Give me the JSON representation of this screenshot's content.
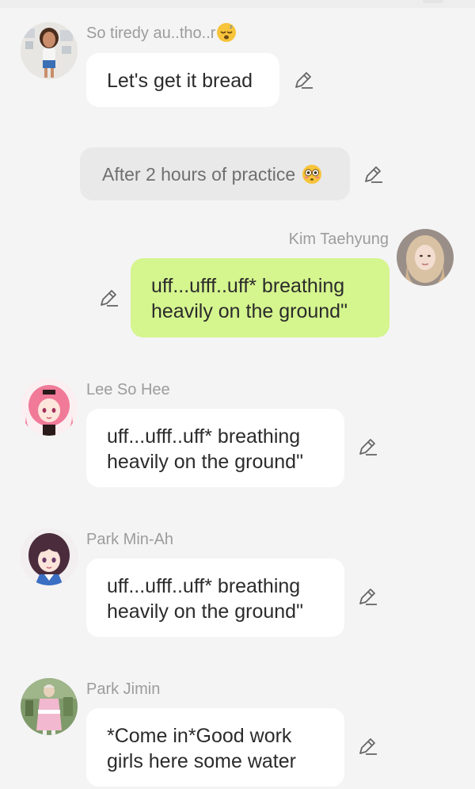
{
  "messages": [
    {
      "sender": "So tiredy au..tho..r",
      "sender_emoji": "sleeping-face",
      "text": "Let's get it bread",
      "side": "left",
      "avatar": "avatar-doll-icon"
    },
    {
      "type": "narration",
      "text": "After 2 hours of practice",
      "emoji": "flushed-face"
    },
    {
      "sender": "Kim Taehyung",
      "text": "uff...ufff..uff* breathing heavily on the ground\"",
      "side": "right",
      "avatar": "avatar-blonde-icon"
    },
    {
      "sender": "Lee So Hee",
      "text": "uff...ufff..uff* breathing heavily on the ground\"",
      "side": "left",
      "avatar": "avatar-pink-anime-icon"
    },
    {
      "sender": "Park Min-Ah",
      "text": "uff...ufff..uff* breathing heavily on the ground\"",
      "side": "left",
      "avatar": "avatar-brown-anime-icon"
    },
    {
      "sender": "Park Jimin",
      "text": "*Come in*Good work girls here some water",
      "side": "left",
      "avatar": "avatar-pink-outfit-icon"
    }
  ],
  "colors": {
    "background": "#f4f4f4",
    "bubble": "#ffffff",
    "self_bubble": "#d5f58e",
    "narration_bubble": "#e9e9e9",
    "name": "#9c9c9c"
  }
}
